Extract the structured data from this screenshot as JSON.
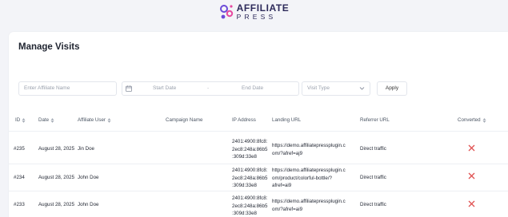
{
  "brand": {
    "line1": "AFFILIATE",
    "line2": "PRESS",
    "accent": "#6c4ad8",
    "accent2": "#e64aa0"
  },
  "page": {
    "title": "Manage Visits"
  },
  "filters": {
    "affiliate_placeholder": "Enter Affiliate Name",
    "start_date_placeholder": "Start Date",
    "separator": "-",
    "end_date_placeholder": "End Date",
    "visit_type_placeholder": "Visit Type",
    "apply_label": "Apply"
  },
  "table": {
    "columns": [
      "ID",
      "Date",
      "Affiliate User",
      "Campaign Name",
      "IP Address",
      "Landing URL",
      "Referrer URL",
      "Converted"
    ],
    "rows": [
      {
        "id": "#235",
        "date": "August 28, 2025",
        "user": "Jin Doe",
        "campaign": "",
        "ip": [
          "2401:4900:8fc8:",
          "2ec8:248a:86b5",
          ":309d:33e8"
        ],
        "url": [
          "https://demo.affiliatepressplugin.c",
          "om/?afref=aj9"
        ],
        "referrer": "Direct traffic",
        "converted": false
      },
      {
        "id": "#234",
        "date": "August 28, 2025",
        "user": "John Doe",
        "campaign": "",
        "ip": [
          "2401:4900:8fc8:",
          "2ec8:248a:86b5",
          ":309d:33e8"
        ],
        "url": [
          "https://demo.affiliatepressplugin.c",
          "om/product/colorful-bottle/?",
          "afref=ai9"
        ],
        "referrer": "Direct traffic",
        "converted": false
      },
      {
        "id": "#233",
        "date": "August 28, 2025",
        "user": "John Doe",
        "campaign": "",
        "ip": [
          "2401:4900:8fc8:",
          "2ec8:248a:86b5",
          ":309d:33e8"
        ],
        "url": [
          "https://demo.affiliatepressplugin.c",
          "om/?afref=ai9"
        ],
        "referrer": "Direct traffic",
        "converted": false
      }
    ]
  },
  "colors": {
    "not_converted": "#e05252"
  }
}
